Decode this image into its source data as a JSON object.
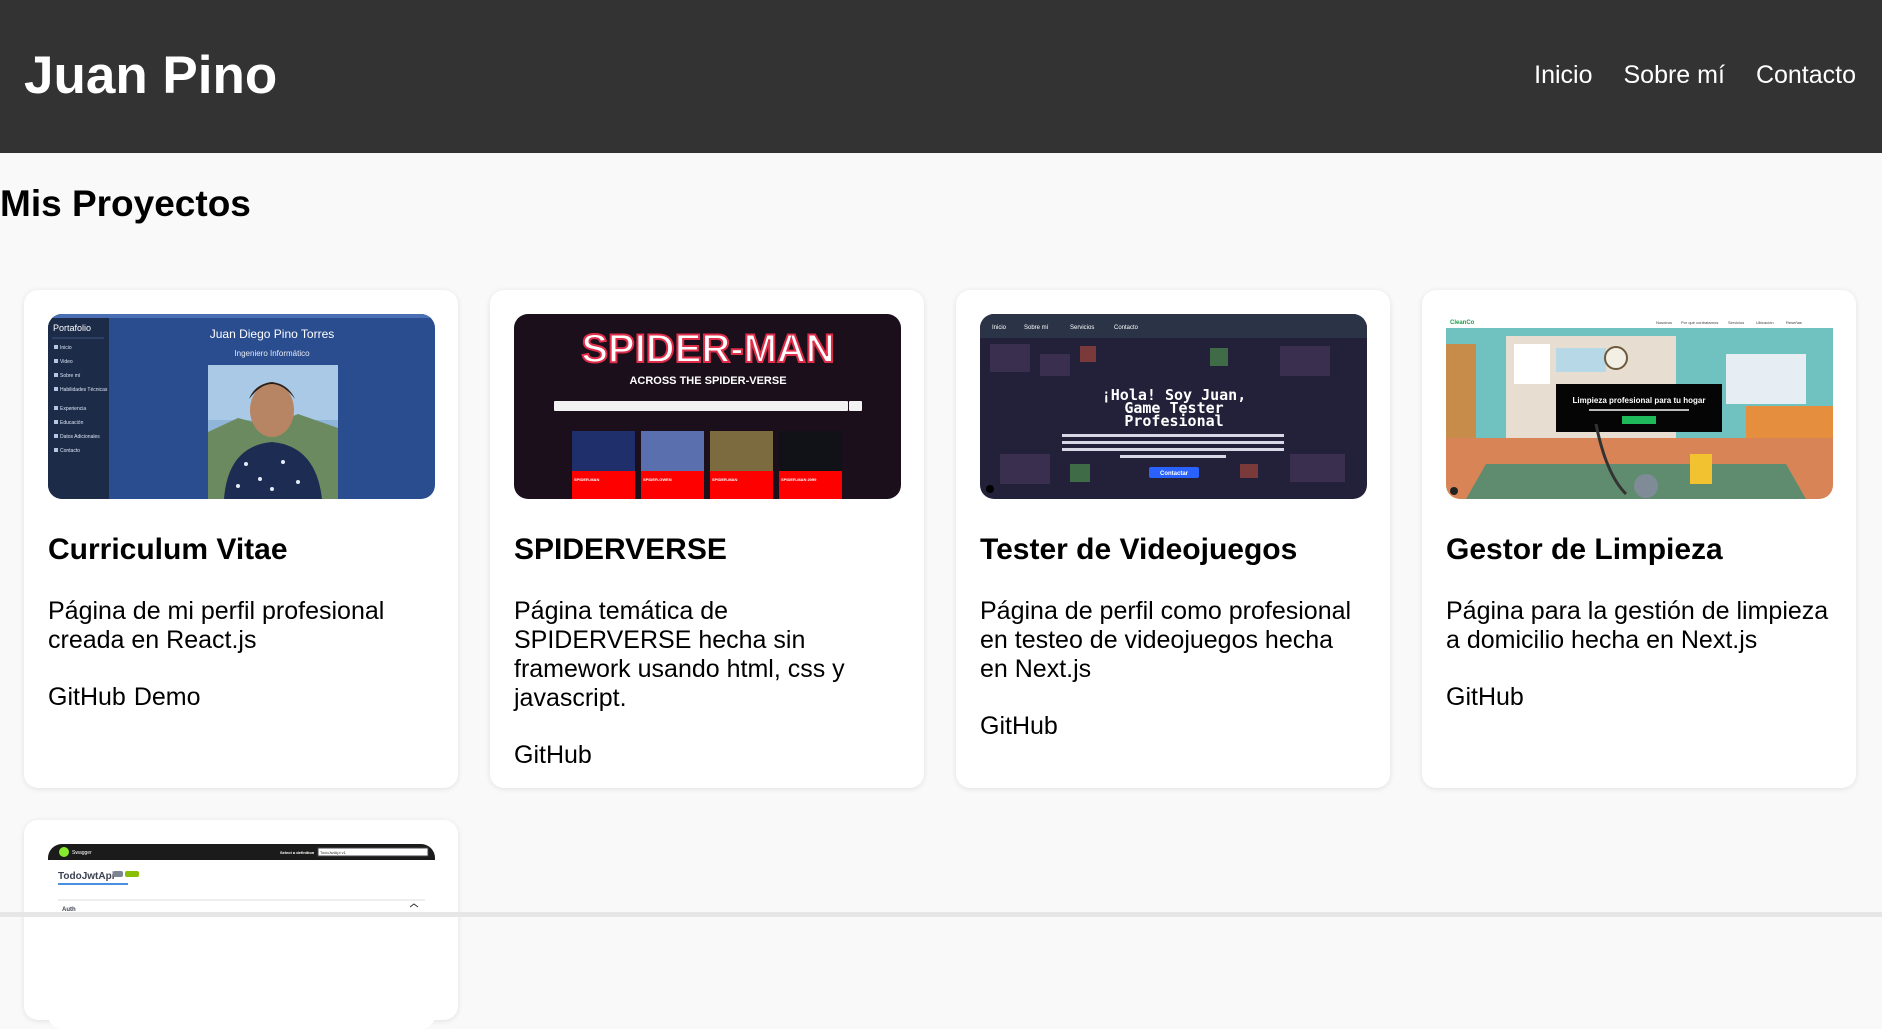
{
  "header": {
    "brand": "Juan Pino",
    "nav": [
      "Inicio",
      "Sobre mí",
      "Contacto"
    ]
  },
  "section_title": "Mis Proyectos",
  "projects": [
    {
      "title": "Curriculum Vitae",
      "description": "Página de mi perfil profesional creada en React.js",
      "links": [
        "GitHub",
        "Demo"
      ],
      "thumb": {
        "sidebar_title": "Portafolio",
        "sidebar_items": [
          "Inicio",
          "Video",
          "Sobre mí",
          "Habilidades Técnicas",
          "Experiencia",
          "Educación",
          "Datos Adicionales",
          "Contacto"
        ],
        "name": "Juan Diego Pino Torres",
        "role": "Ingeniero Informático"
      }
    },
    {
      "title": "SPIDERVERSE",
      "description": "Página temática de SPIDERVERSE hecha sin framework usando html, css y javascript.",
      "links": [
        "GitHub"
      ],
      "thumb": {
        "logo": "SPIDER-MAN",
        "subtitle": "ACROSS THE SPIDER-VERSE",
        "cards": [
          "SPIDER-MAN",
          "SPIDER-GWEN",
          "SPIDER-MAN",
          "SPIDER-MAN 2099"
        ]
      }
    },
    {
      "title": "Tester de Videojuegos",
      "description": "Página de perfil como profesional en testeo de videojuegos hecha en Next.js",
      "links": [
        "GitHub"
      ],
      "thumb": {
        "nav": [
          "Inicio",
          "Sobre mí",
          "Servicios",
          "Contacto"
        ],
        "headline": [
          "¡Hola! Soy Juan,",
          "Game Tester",
          "Profesional"
        ],
        "button": "Contactar"
      }
    },
    {
      "title": "Gestor de Limpieza",
      "description": "Página para la gestión de limpieza a domicilio hecha en Next.js",
      "links": [
        "GitHub"
      ],
      "thumb": {
        "brand": "CleanCo",
        "nav": [
          "Nosotros",
          "Por qué contratarnos",
          "Servicios",
          "Ubicación",
          "Reseñas"
        ],
        "headline": "Limpieza profesional para tu hogar"
      }
    },
    {
      "title": "",
      "description": "",
      "links": [],
      "thumb": {
        "brand": "Swagger",
        "definition_label": "Select a definition",
        "definition_value": "TodoJwtApi v1",
        "api_title": "TodoJwtApi",
        "section": "Auth"
      }
    }
  ],
  "colors": {
    "header_bg": "#333333",
    "page_bg": "#f9f9f9",
    "card_bg": "#ffffff"
  }
}
